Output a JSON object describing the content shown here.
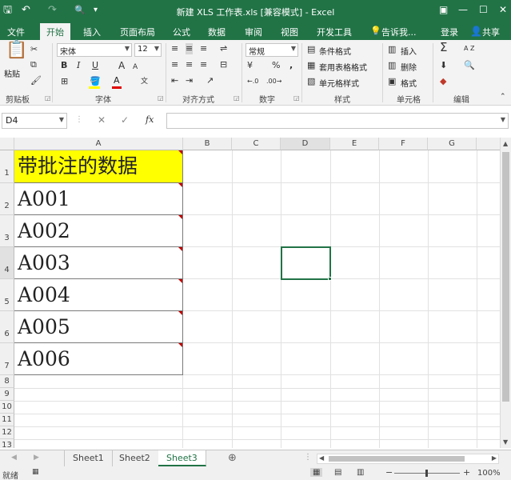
{
  "window": {
    "title": "新建 XLS 工作表.xls  [兼容模式] - Excel",
    "controls": [
      "▣",
      "—",
      "☐",
      "✕"
    ]
  },
  "quick_access": {
    "save": "🖫",
    "undo": "↶",
    "redo": "↷",
    "preview": "🔍",
    "more": "▾"
  },
  "ribbon_tabs": [
    "文件",
    "开始",
    "插入",
    "页面布局",
    "公式",
    "数据",
    "审阅",
    "视图",
    "开发工具"
  ],
  "active_tab": "开始",
  "tell_me": "告诉我...",
  "login": "登录",
  "share": "共享",
  "clipboard": {
    "paste": "粘贴",
    "group": "剪贴板"
  },
  "font": {
    "name": "宋体",
    "size": "12",
    "group": "字体",
    "bold": "B",
    "italic": "I",
    "underline": "U",
    "grow": "A",
    "shrink": "A",
    "font_color": "A"
  },
  "alignment": {
    "group": "对齐方式"
  },
  "number": {
    "format": "常规",
    "group": "数字",
    "percent": "%",
    "comma": ","
  },
  "styles": {
    "conditional": "条件格式",
    "table": "套用表格格式",
    "cell": "单元格样式",
    "group": "样式"
  },
  "cells": {
    "insert": "插入",
    "delete": "删除",
    "format": "格式",
    "group": "单元格"
  },
  "editing": {
    "group": "编辑",
    "sum": "Σ",
    "sort": "A Z"
  },
  "name_box": "D4",
  "formula_icons": {
    "cancel": "✕",
    "confirm": "✓",
    "fx": "fx"
  },
  "formula_value": "",
  "columns": [
    "A",
    "B",
    "C",
    "D",
    "E",
    "F",
    "G"
  ],
  "rows": [
    "1",
    "2",
    "3",
    "4",
    "5",
    "6",
    "7",
    "8",
    "9",
    "10",
    "11",
    "12",
    "13"
  ],
  "cells_A": [
    "带批注的数据",
    "A001",
    "A002",
    "A003",
    "A004",
    "A005",
    "A006"
  ],
  "header_fill": "#ffff00",
  "comment_marker_color": "#c00000",
  "sheets": [
    "Sheet1",
    "Sheet2",
    "Sheet3"
  ],
  "active_sheet": "Sheet3",
  "add_sheet": "⊕",
  "status": {
    "ready": "就绪",
    "zoom": "100%",
    "zoom_minus": "−",
    "zoom_plus": "+"
  }
}
